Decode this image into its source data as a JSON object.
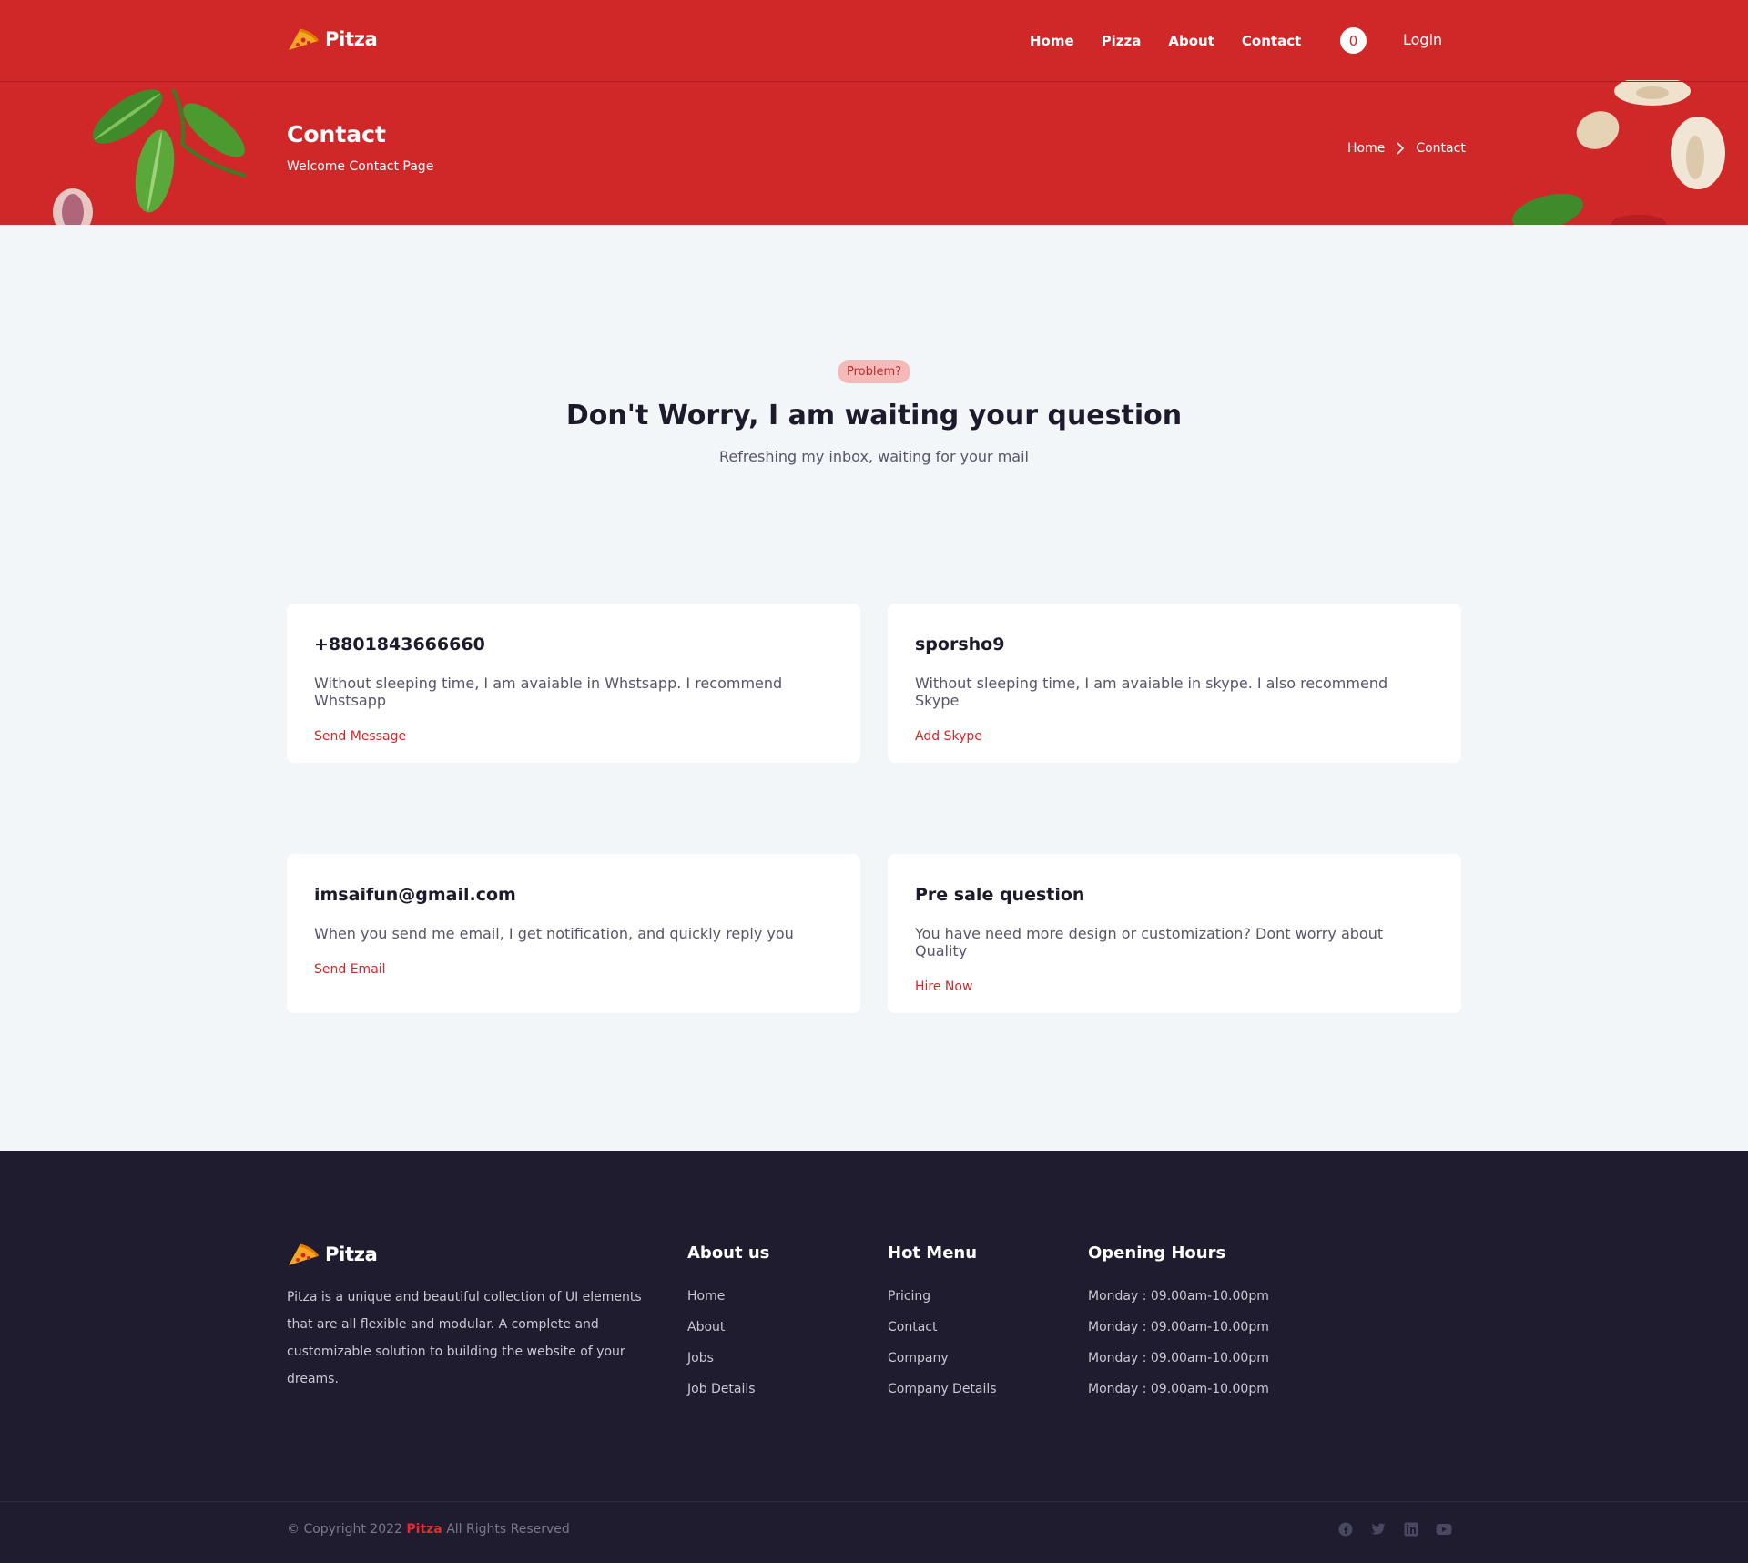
{
  "header": {
    "brand": "Pitza",
    "nav": [
      "Home",
      "Pizza",
      "About",
      "Contact"
    ],
    "cart_count": "0",
    "login_label": "Login"
  },
  "banner": {
    "title": "Contact",
    "subtitle": "Welcome Contact Page",
    "breadcrumb": [
      "Home",
      "Contact"
    ]
  },
  "intro": {
    "badge": "Problem?",
    "heading": "Don't Worry, I am waiting your question",
    "subheading": "Refreshing my inbox, waiting for your mail"
  },
  "cards": [
    {
      "title": "+8801843666660",
      "text": "Without sleeping time, I am avaiable in Whstsapp. I recommend Whstsapp",
      "link": "Send Message"
    },
    {
      "title": "sporsho9",
      "text": "Without sleeping time, I am avaiable in skype. I also recommend Skype",
      "link": "Add Skype"
    },
    {
      "title": "imsaifun@gmail.com",
      "text": "When you send me email, I get notification, and quickly reply you",
      "link": "Send Email"
    },
    {
      "title": "Pre sale question",
      "text": "You have need more design or customization? Dont worry about Quality",
      "link": "Hire Now"
    }
  ],
  "footer": {
    "brand": "Pitza",
    "description": "Pitza is a unique and beautiful collection of UI elements that are all flexible and modular. A complete and customizable solution to building the website of your dreams.",
    "columns": [
      {
        "title": "About us",
        "items": [
          "Home",
          "About",
          "Jobs",
          "Job Details"
        ]
      },
      {
        "title": "Hot Menu",
        "items": [
          "Pricing",
          "Contact",
          "Company",
          "Company Details"
        ]
      },
      {
        "title": "Opening Hours",
        "items": [
          "Monday : 09.00am-10.00pm",
          "Monday : 09.00am-10.00pm",
          "Monday : 09.00am-10.00pm",
          "Monday : 09.00am-10.00pm"
        ]
      }
    ],
    "copyright_prefix": "© Copyright 2022",
    "copyright_brand": "Pitza",
    "copyright_suffix": "All Rights Reserved",
    "socials": [
      "facebook-icon",
      "twitter-icon",
      "linkedin-icon",
      "youtube-icon"
    ]
  },
  "colors": {
    "brand_red": "#d02729",
    "page_bg": "#f3f6f9",
    "footer_bg": "#1e1c2e",
    "badge_bg": "#f4b9b9"
  }
}
